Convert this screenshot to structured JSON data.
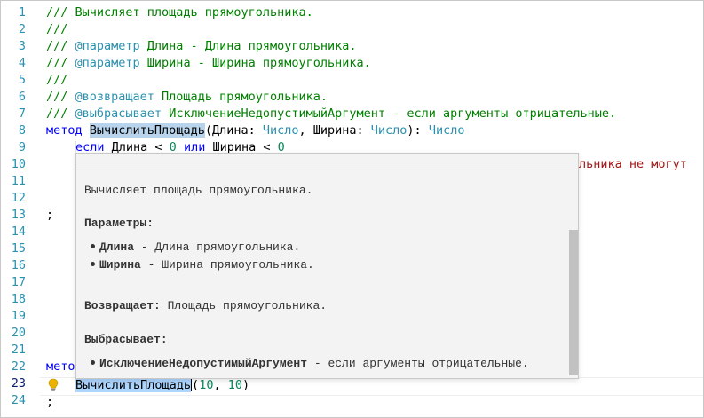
{
  "gutter": [
    "1",
    "2",
    "3",
    "4",
    "5",
    "6",
    "7",
    "8",
    "9",
    "10",
    "11",
    "12",
    "13",
    "14",
    "15",
    "16",
    "17",
    "18",
    "19",
    "20",
    "21",
    "22",
    "23",
    "24"
  ],
  "active_line": "23",
  "lines": {
    "l1": "/// Вычисляет площадь прямоугольника.",
    "l2": "///",
    "l3_a": "/// ",
    "l3_tag": "@параметр",
    "l3_b": " Длина - Длина прямоугольника.",
    "l4_a": "/// ",
    "l4_tag": "@параметр",
    "l4_b": " Ширина - Ширина прямоугольника.",
    "l5": "///",
    "l6_a": "/// ",
    "l6_tag": "@возвращает",
    "l6_b": " Площадь прямоугольника.",
    "l7_a": "/// ",
    "l7_tag": "@выбрасывает",
    "l7_b": " ИсключениеНедопустимыйАргумент - если аргументы отрицательные.",
    "l8_kw": "метод",
    "l8_name": "ВычислитьПлощадь",
    "l8_p1": "(Длина: ",
    "l8_t1": "Число",
    "l8_p2": ", Ширина: ",
    "l8_t2": "Число",
    "l8_p3": "): ",
    "l8_t3": "Число",
    "l9_kw1": "если",
    "l9_a": " Длина < ",
    "l9_n1": "0",
    "l9_kw2": " или",
    "l9_b": " Ширина < ",
    "l9_n2": "0",
    "l10_str": "льника не могут",
    "l13": ";",
    "l22_kw": "мето",
    "l23_name": "ВычислитьПлощадь",
    "l23_a": "(",
    "l23_n1": "10",
    "l23_b": ", ",
    "l23_n2": "10",
    "l23_c": ")",
    "l24": ";"
  },
  "tooltip": {
    "description": "Вычисляет площадь прямоугольника.",
    "params_heading": "Параметры:",
    "params": [
      {
        "name": "Длина",
        "text": " - Длина прямоугольника."
      },
      {
        "name": "Ширина",
        "text": " - Ширина прямоугольника."
      }
    ],
    "returns_heading": "Возвращает:",
    "returns_text": " Площадь прямоугольника.",
    "throws_heading": "Выбрасывает:",
    "throws": [
      {
        "name": "ИсключениеНедопустимыйАргумент",
        "text": " - если аргументы отрицательные."
      }
    ]
  },
  "colors": {
    "comment": "#008000",
    "keyword": "#0000ff",
    "type": "#2b91af",
    "number": "#098658",
    "string": "#a31515",
    "line_number": "#2b91af",
    "selection": "#add6ff"
  },
  "icons": {
    "lightbulb": "lightbulb-icon"
  }
}
